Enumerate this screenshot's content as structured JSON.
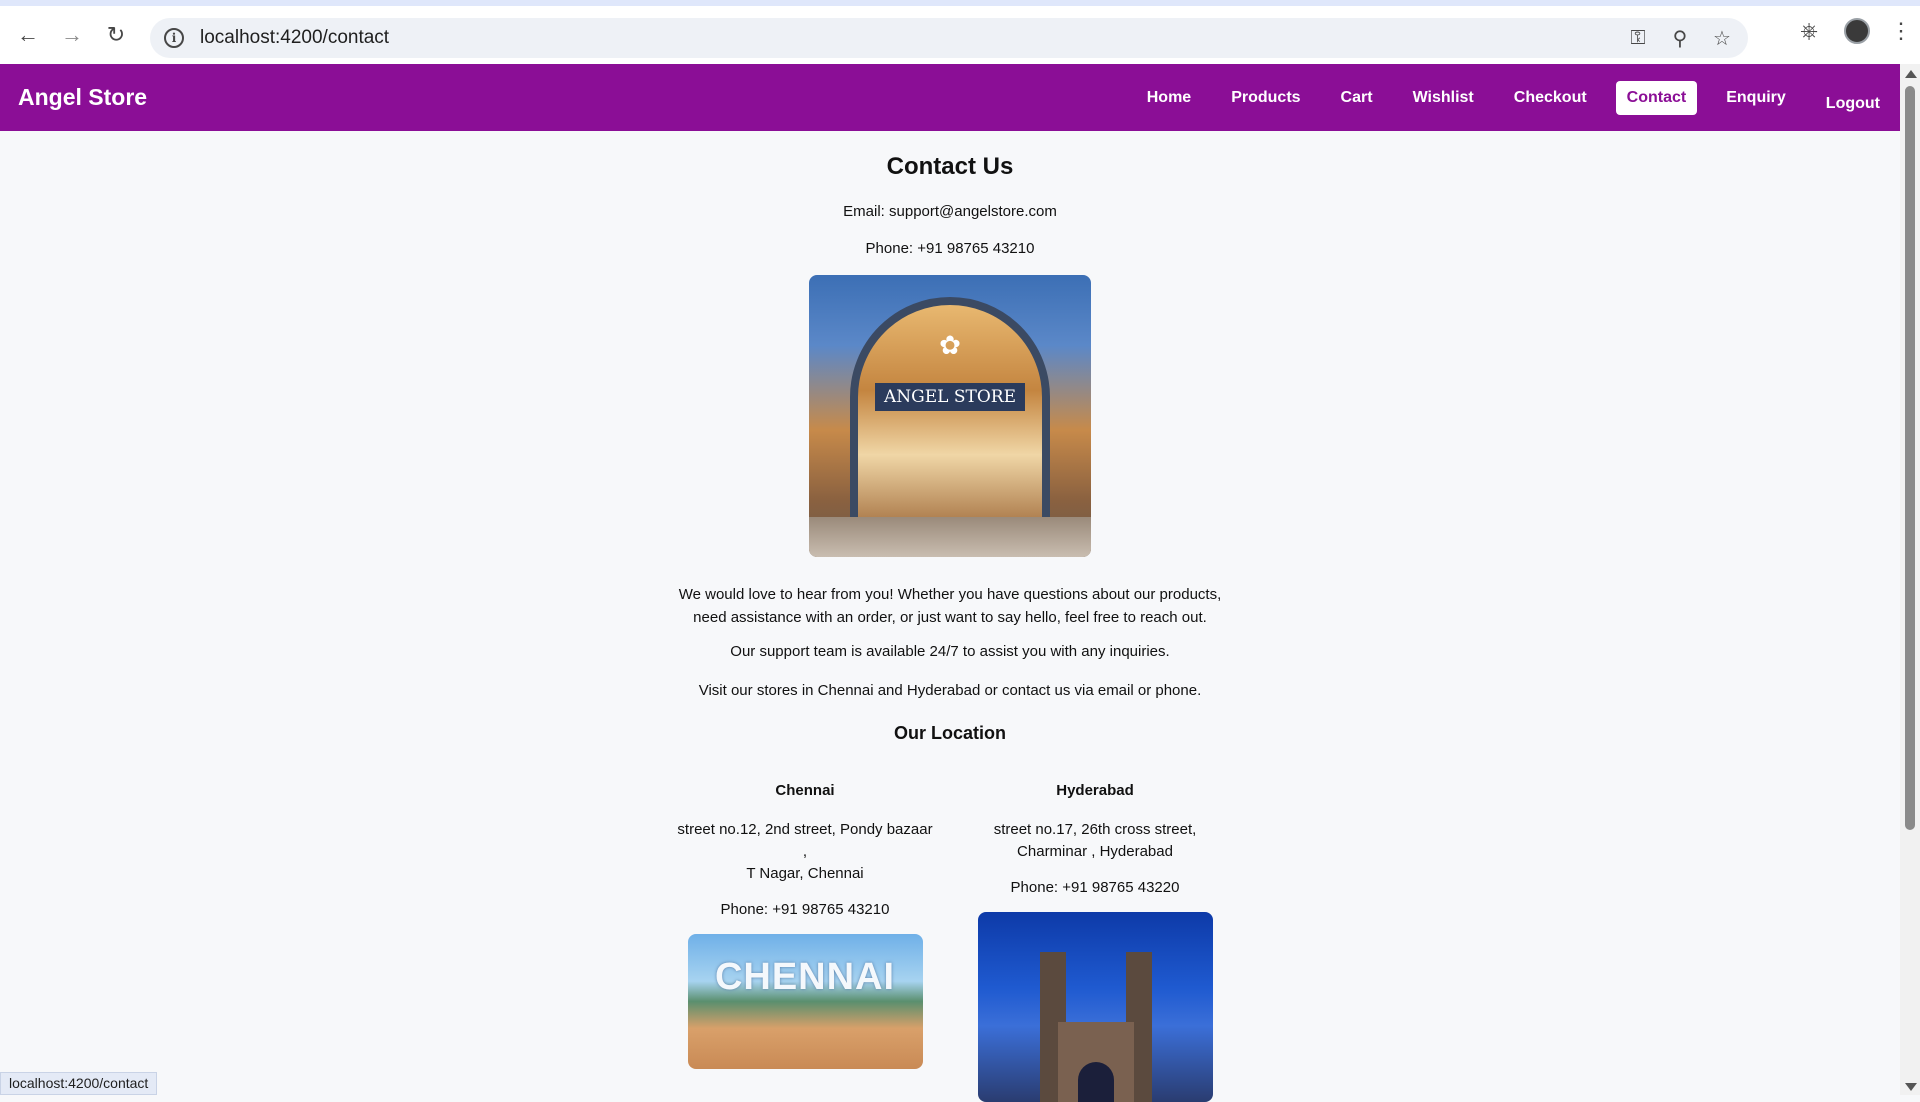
{
  "browser": {
    "url": "localhost:4200/contact",
    "status_url": "localhost:4200/contact"
  },
  "header": {
    "brand": "Angel Store",
    "nav": {
      "home": "Home",
      "products": "Products",
      "cart": "Cart",
      "wishlist": "Wishlist",
      "checkout": "Checkout",
      "contact": "Contact",
      "enquiry": "Enquiry",
      "logout": "Logout"
    },
    "active_tab": "Contact",
    "bar_color": "#8b0e96"
  },
  "contact": {
    "title": "Contact Us",
    "email": "Email: support@angelstore.com",
    "phone": "Phone: +91 98765 43210",
    "hero_sign": "ANGEL STORE",
    "paragraph_1a": "We would love to hear from you! Whether you have questions about our products,",
    "paragraph_1b": "need assistance with an order, or just want to say hello, feel free to reach out.",
    "paragraph_2": "Our support team is available 24/7 to assist you with any inquiries.",
    "paragraph_3": "Visit our stores in Chennai and Hyderabad or contact us via email or phone."
  },
  "locations": {
    "title": "Our Location",
    "chennai": {
      "city": "Chennai",
      "address_1": "street no.12, 2nd street, Pondy bazaar ,",
      "address_2": "T Nagar, Chennai",
      "phone": "Phone: +91 98765 43210",
      "image_text": "CHENNAI"
    },
    "hyderabad": {
      "city": "Hyderabad",
      "address_1": "street no.17, 26th cross street,",
      "address_2": "Charminar , Hyderabad",
      "phone": "Phone: +91 98765 43220"
    }
  }
}
